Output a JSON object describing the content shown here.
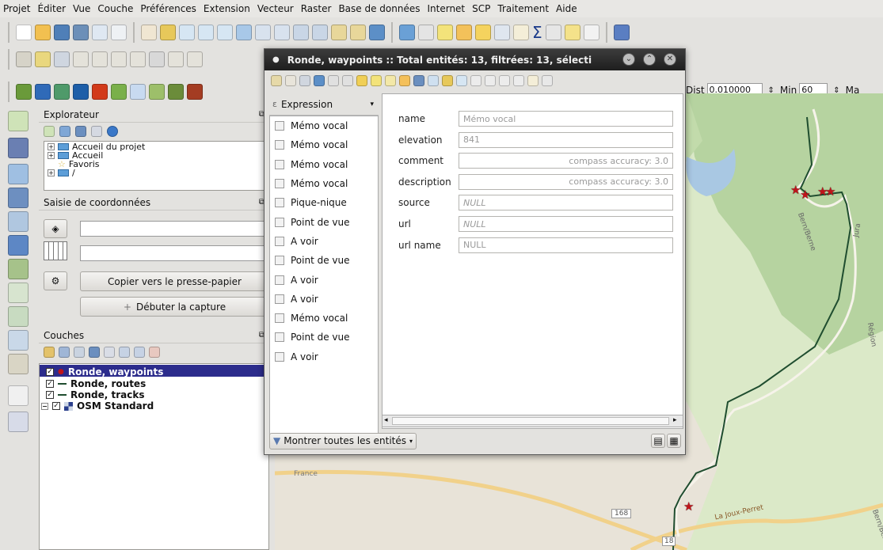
{
  "menu": [
    "Projet",
    "Éditer",
    "Vue",
    "Couche",
    "Préférences",
    "Extension",
    "Vecteur",
    "Raster",
    "Base de données",
    "Internet",
    "SCP",
    "Traitement",
    "Aide"
  ],
  "colors": {
    "map_forest": "#b6d3a0",
    "map_bg": "#dbe9c8",
    "route": "#1f4d2f",
    "star": "#c0141a",
    "selection": "#2c2c8c",
    "water": "#a9c8e3"
  },
  "toolbar3": {
    "dist_label": "Dist",
    "dist_value": "0.010000",
    "min_label": "Min",
    "min_value": "60",
    "max_label": "Ma"
  },
  "explorer": {
    "title": "Explorateur",
    "items": [
      {
        "label": "Accueil du projet",
        "icon": "folder-icon"
      },
      {
        "label": "Accueil",
        "icon": "folder-icon"
      },
      {
        "label": "Favoris",
        "icon": "star-icon"
      },
      {
        "label": "/",
        "icon": "folder-icon"
      }
    ]
  },
  "coords": {
    "title": "Saisie de coordonnées",
    "copy_button": "Copier vers le presse-papier",
    "capture_button": "Débuter la capture"
  },
  "layers": {
    "title": "Couches",
    "items": [
      {
        "label": "Ronde, waypoints",
        "selected": true,
        "icon": "point-layer-icon"
      },
      {
        "label": "Ronde, routes",
        "selected": false,
        "icon": "line-layer-icon"
      },
      {
        "label": "Ronde, tracks",
        "selected": false,
        "icon": "line-layer-icon"
      },
      {
        "label": "OSM Standard",
        "selected": false,
        "icon": "raster-layer-icon"
      }
    ]
  },
  "dialog": {
    "title": "Ronde, waypoints :: Total entités: 13, filtrées: 13, sélecti",
    "expression_label": "Expression",
    "list": [
      "Mémo vocal",
      "Mémo vocal",
      "Mémo vocal",
      "Mémo vocal",
      "Pique-nique",
      "Point de vue",
      "A voir",
      "Point de vue",
      "A voir",
      "A voir",
      "Mémo vocal",
      "Point de vue",
      "A voir"
    ],
    "fields": [
      {
        "label": "name",
        "value": "Mémo vocal",
        "align": "left",
        "italic": false
      },
      {
        "label": "elevation",
        "value": "841",
        "align": "left",
        "italic": false
      },
      {
        "label": "comment",
        "value": "compass accuracy: 3.0",
        "align": "right",
        "italic": false
      },
      {
        "label": "description",
        "value": "compass accuracy: 3.0",
        "align": "right",
        "italic": false
      },
      {
        "label": "source",
        "value": "NULL",
        "align": "left",
        "italic": true
      },
      {
        "label": "url",
        "value": "NULL",
        "align": "left",
        "italic": true
      },
      {
        "label": "url name",
        "value": "NULL",
        "align": "left",
        "italic": false
      }
    ],
    "footer_button": "Montrer toutes les entités"
  },
  "map": {
    "labels": [
      "France",
      "168",
      "La Joux-Perret",
      "Bern/Berne",
      "Jura",
      "Région",
      "18",
      "Bern/Berne"
    ]
  }
}
